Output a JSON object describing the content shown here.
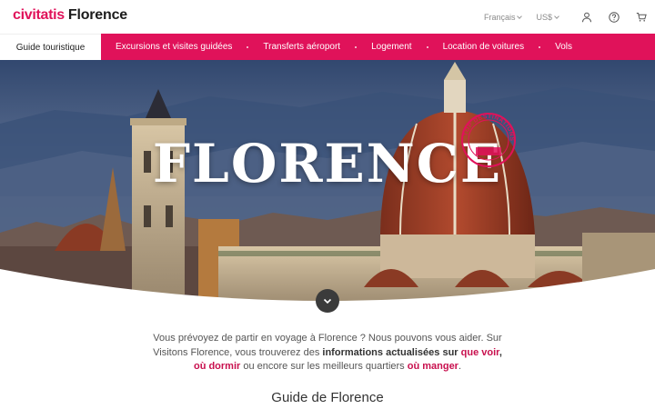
{
  "header": {
    "brand": "civitatis",
    "city": "Florence",
    "language": "Français",
    "currency": "US$",
    "icons": [
      "user-icon",
      "help-icon",
      "cart-icon"
    ]
  },
  "nav": {
    "guide_label": "Guide touristique",
    "items": [
      "Excursions et visites guidées",
      "Transferts aéroport",
      "Logement",
      "Location de voitures",
      "Vols"
    ]
  },
  "hero": {
    "title": "FLORENCE",
    "stamp_text": "TOP DESTINATIONS 2020",
    "scroll_icon": "chevron-down-icon"
  },
  "intro": {
    "p1": "Vous prévoyez de partir en voyage à Florence ? Nous pouvons vous aider. Sur Visitons Florence, vous trouverez des ",
    "b1": "informations actualisées sur ",
    "l1": "que voir",
    "t2": ", ",
    "l2": "où dormir",
    "t3": " ou encore sur les meilleurs quartiers ",
    "l3": "où manger",
    "t4": "."
  },
  "section_title": "Guide de Florence",
  "colors": {
    "brand_pink": "#e0125a",
    "link_pink": "#c8104e"
  }
}
